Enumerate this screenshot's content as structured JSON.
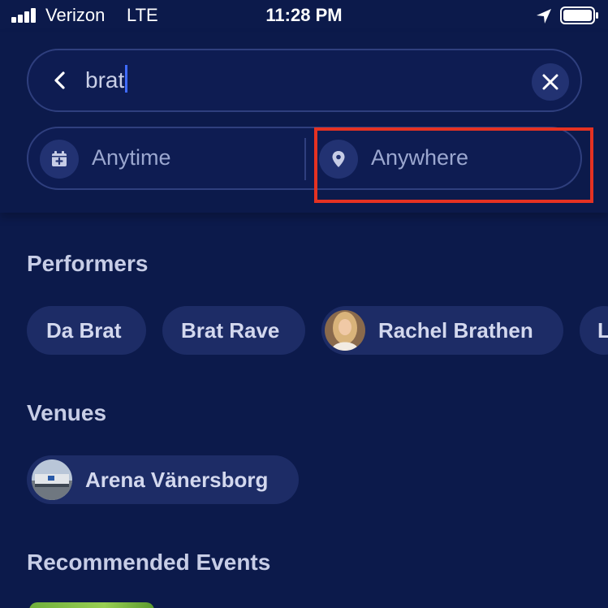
{
  "status_bar": {
    "carrier": "Verizon",
    "network": "LTE",
    "time": "11:28 PM",
    "icons": [
      "signal-icon",
      "location-arrow-icon",
      "battery-icon"
    ]
  },
  "search": {
    "query": "brat",
    "icons": {
      "back": "chevron-left-icon",
      "clear": "close-icon"
    }
  },
  "filters": {
    "date_label": "Anytime",
    "location_label": "Anywhere",
    "icons": {
      "date": "calendar-icon",
      "location": "map-pin-icon"
    },
    "highlight_color": "#e53222"
  },
  "performers": {
    "title": "Performers",
    "items": [
      {
        "label": "Da Brat"
      },
      {
        "label": "Brat Rave"
      },
      {
        "label": "Rachel Brathen"
      },
      {
        "label": "L"
      }
    ]
  },
  "venues": {
    "title": "Venues",
    "items": [
      {
        "label": "Arena Vänersborg"
      }
    ]
  },
  "recommended": {
    "title": "Recommended Events"
  },
  "colors": {
    "background": "#0c1a4b",
    "chip": "#1d2c66",
    "accent_caret": "#3f6bff"
  }
}
